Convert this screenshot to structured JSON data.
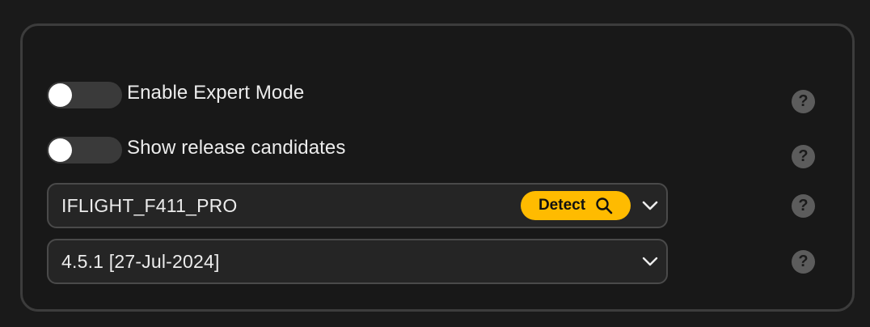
{
  "settings": {
    "expert_mode": {
      "label": "Enable Expert Mode",
      "enabled": false
    },
    "release_candidates": {
      "label": "Show release candidates",
      "enabled": false
    }
  },
  "board_select": {
    "value": "IFLIGHT_F411_PRO",
    "detect_label": "Detect"
  },
  "firmware_select": {
    "value": "4.5.1 [27-Jul-2024]"
  },
  "help_glyph": "?",
  "colors": {
    "background": "#1a1a1a",
    "panel_border": "#3c3c3c",
    "accent": "#ffbb00",
    "help_icon": "#5c5c5c"
  }
}
